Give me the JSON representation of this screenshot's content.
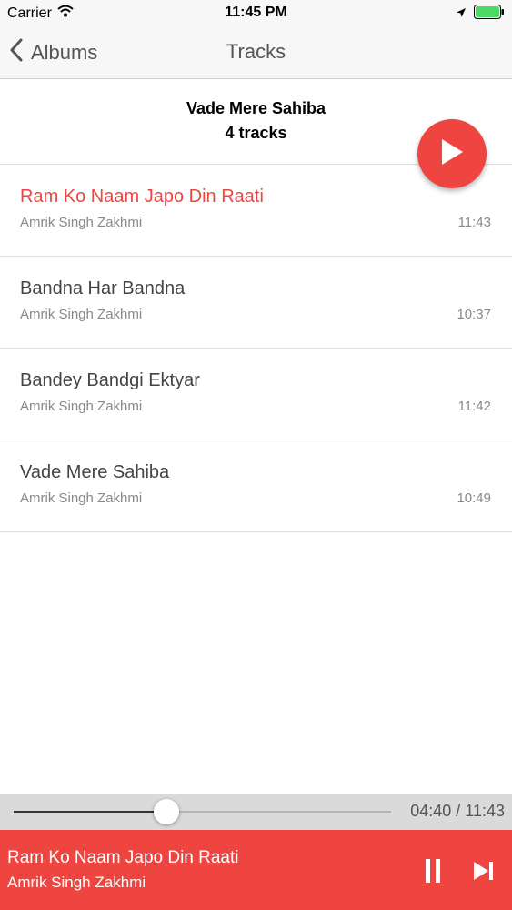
{
  "status_bar": {
    "carrier": "Carrier",
    "time": "11:45 PM"
  },
  "nav": {
    "back_label": "Albums",
    "title": "Tracks"
  },
  "album": {
    "title": "Vade Mere Sahiba",
    "track_count": "4 tracks"
  },
  "tracks": [
    {
      "title": "Ram Ko Naam Japo Din Raati",
      "artist": "Amrik Singh Zakhmi",
      "duration": "11:43",
      "active": true
    },
    {
      "title": "Bandna Har Bandna",
      "artist": "Amrik Singh Zakhmi",
      "duration": "10:37",
      "active": false
    },
    {
      "title": "Bandey Bandgi Ektyar",
      "artist": "Amrik Singh Zakhmi",
      "duration": "11:42",
      "active": false
    },
    {
      "title": "Vade Mere Sahiba",
      "artist": "Amrik Singh Zakhmi",
      "duration": "10:49",
      "active": false
    }
  ],
  "player": {
    "progress_fraction": 0.405,
    "time_display": "04:40 / 11:43",
    "now_playing_title": "Ram Ko Naam Japo Din Raati",
    "now_playing_artist": "Amrik Singh Zakhmi"
  },
  "icons": {
    "back": "chevron-left-icon",
    "wifi": "wifi-icon",
    "location": "location-arrow-icon",
    "battery": "battery-icon",
    "play": "play-icon",
    "pause": "pause-icon",
    "next": "skip-next-icon"
  },
  "colors": {
    "accent": "#ee4540",
    "battery": "#4cd964"
  }
}
